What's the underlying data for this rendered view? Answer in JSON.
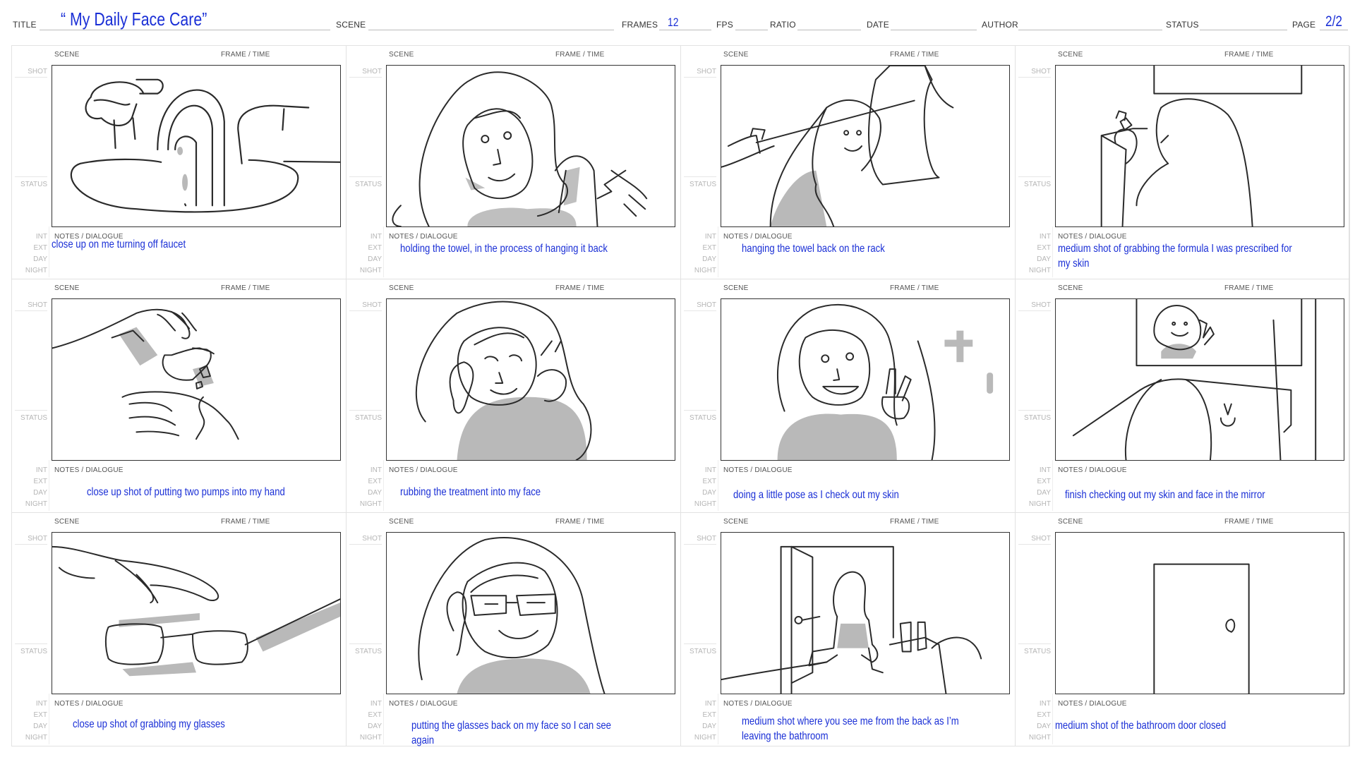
{
  "header": {
    "title_label": "TITLE",
    "title_value": "“ My Daily Face Care”",
    "scene_label": "SCENE",
    "frames_label": "FRAMES",
    "frames_value": "12",
    "fps_label": "FPS",
    "ratio_label": "RATIO",
    "date_label": "DATE",
    "author_label": "AUTHOR",
    "status_label": "STATUS",
    "page_label": "PAGE",
    "page_value": "2/2"
  },
  "cell_labels": {
    "scene": "SCENE",
    "frame_time": "FRAME / TIME",
    "shot": "SHOT",
    "status": "STATUS",
    "notes": "NOTES / DIALOGUE",
    "int": "INT",
    "ext": "EXT",
    "day": "DAY",
    "night": "NIGHT"
  },
  "panels": [
    {
      "sketch": "faucet-closeup",
      "note": "close up on me turning off faucet"
    },
    {
      "sketch": "holding-towel",
      "note": "holding the towel, in the process of hanging it back"
    },
    {
      "sketch": "towel-rack",
      "note": "hanging the towel back on the rack"
    },
    {
      "sketch": "grabbing-formula",
      "note": "medium shot of grabbing the formula I was prescribed for my skin"
    },
    {
      "sketch": "pumps-into-hand",
      "note": "close up shot of putting two pumps into my hand"
    },
    {
      "sketch": "rubbing-face",
      "note": "rubbing the treatment into my face"
    },
    {
      "sketch": "pose-peace",
      "note": "doing a little pose as I check out my skin"
    },
    {
      "sketch": "mirror-check",
      "note": "finish checking out my skin and face in the mirror"
    },
    {
      "sketch": "grabbing-glasses",
      "note": "close up shot of grabbing my glasses"
    },
    {
      "sketch": "glasses-on",
      "note": "putting the glasses back on my face so I can see again"
    },
    {
      "sketch": "leaving-bathroom",
      "note": "medium shot  where you see me from the back as I’m leaving the bathroom"
    },
    {
      "sketch": "door-closed",
      "note": "medium shot of the bathroom door closed"
    }
  ],
  "colors": {
    "ink": "#1a2fd6",
    "sketch": "#2a2a2a",
    "shade": "#b9b9b9"
  }
}
